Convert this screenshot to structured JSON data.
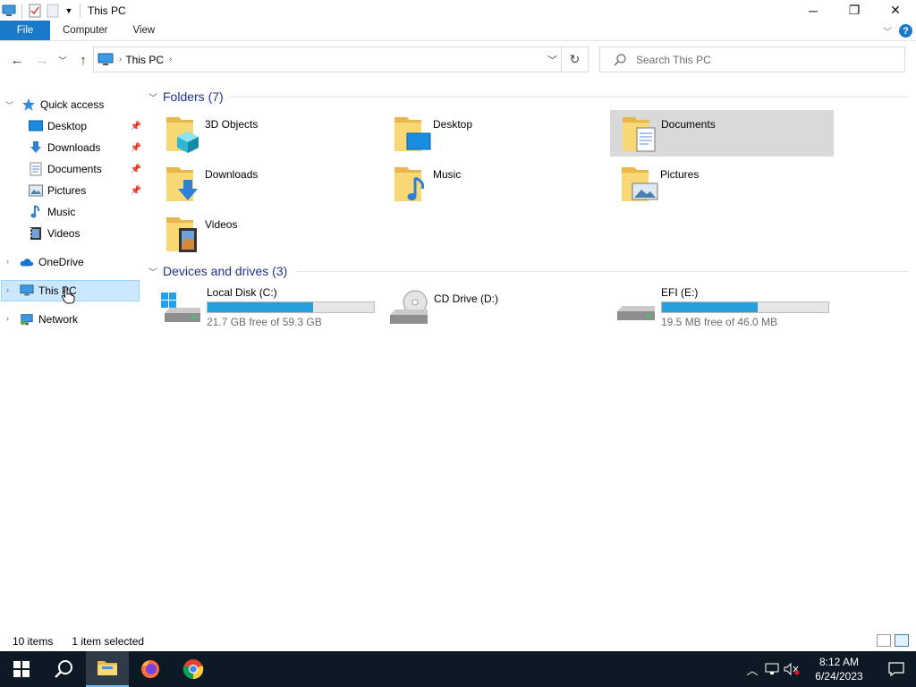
{
  "window": {
    "title": "This PC",
    "controls": {
      "minimize": "─",
      "restore": "❐",
      "close": "✕"
    }
  },
  "ribbon": {
    "tabs": [
      {
        "label": "File",
        "active": true
      },
      {
        "label": "Computer"
      },
      {
        "label": "View"
      }
    ],
    "help_label": "?"
  },
  "address": {
    "path": [
      {
        "label": "This PC"
      }
    ],
    "search_placeholder": "Search This PC"
  },
  "navpane": {
    "items": [
      {
        "label": "Quick access",
        "icon": "star-icon",
        "expander": "expanded"
      },
      {
        "label": "Desktop",
        "icon": "desktop-icon",
        "pinned": true
      },
      {
        "label": "Downloads",
        "icon": "downloads-icon",
        "pinned": true
      },
      {
        "label": "Documents",
        "icon": "documents-icon",
        "pinned": true
      },
      {
        "label": "Pictures",
        "icon": "pictures-icon",
        "pinned": true
      },
      {
        "label": "Music",
        "icon": "music-icon"
      },
      {
        "label": "Videos",
        "icon": "videos-icon"
      },
      {
        "label": "OneDrive",
        "icon": "cloud-icon",
        "expander": "collapsed"
      },
      {
        "label": "This PC",
        "icon": "computer-icon",
        "expander": "collapsed",
        "selected": true
      },
      {
        "label": "Network",
        "icon": "network-icon",
        "expander": "collapsed"
      }
    ]
  },
  "content": {
    "folders_header": "Folders (7)",
    "folders": [
      {
        "label": "3D Objects",
        "icon": "3d-objects-folder-icon"
      },
      {
        "label": "Desktop",
        "icon": "desktop-folder-icon"
      },
      {
        "label": "Documents",
        "icon": "documents-folder-icon",
        "selected": true
      },
      {
        "label": "Downloads",
        "icon": "downloads-folder-icon"
      },
      {
        "label": "Music",
        "icon": "music-folder-icon"
      },
      {
        "label": "Pictures",
        "icon": "pictures-folder-icon"
      },
      {
        "label": "Videos",
        "icon": "videos-folder-icon"
      }
    ],
    "drives_header": "Devices and drives (3)",
    "drives": [
      {
        "label": "Local Disk (C:)",
        "free": "21.7 GB free of 59.3 GB",
        "used_fraction": 0.634,
        "icon": "windows-drive-icon"
      },
      {
        "label": "CD Drive (D:)",
        "free": "",
        "icon": "cd-drive-icon"
      },
      {
        "label": "EFI (E:)",
        "free": "19.5 MB free of 46.0 MB",
        "used_fraction": 0.576,
        "icon": "drive-icon"
      }
    ]
  },
  "status": {
    "items_count": "10 items",
    "selection": "1 item selected"
  },
  "taskbar": {
    "apps": [
      {
        "name": "start",
        "icon": "windows-logo-icon"
      },
      {
        "name": "search",
        "icon": "search-icon"
      },
      {
        "name": "file-explorer",
        "icon": "folder-icon",
        "active": true
      },
      {
        "name": "firefox",
        "icon": "firefox-icon"
      },
      {
        "name": "chrome",
        "icon": "chrome-icon"
      }
    ],
    "time": "8:12 AM",
    "date": "6/24/2023"
  },
  "colors": {
    "accent": "#1979ca",
    "selection": "#cce8ff",
    "drive_bar": "#26a0da",
    "taskbar": "#0d1a26",
    "group_header": "#1e3287"
  }
}
